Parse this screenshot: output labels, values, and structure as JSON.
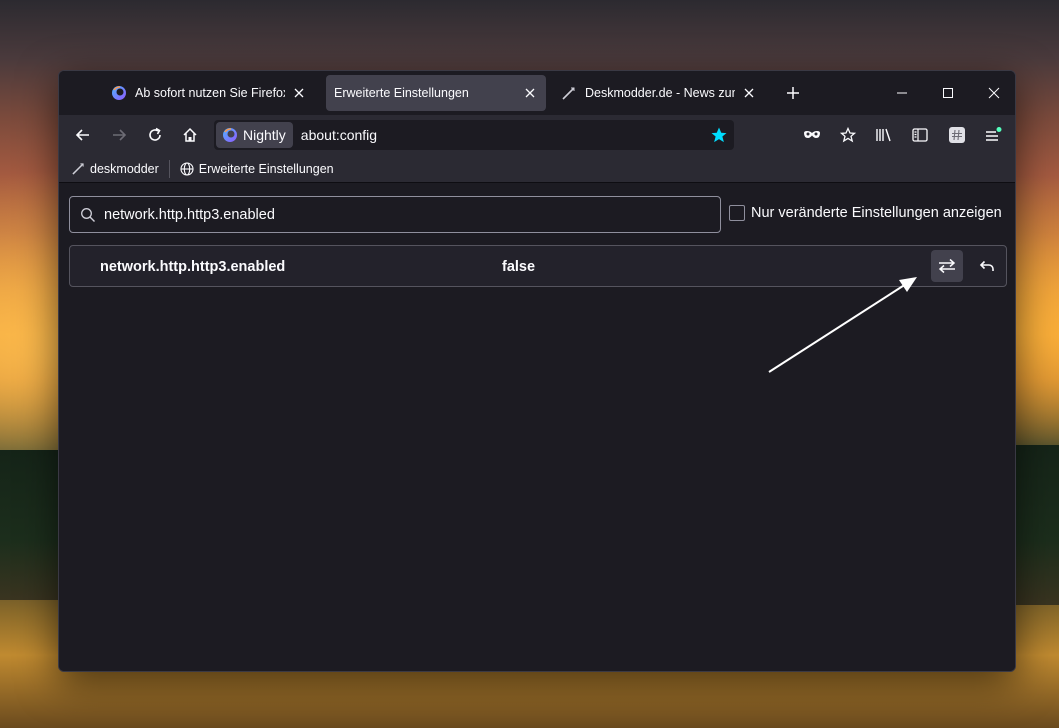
{
  "tabs": [
    {
      "title": "Ab sofort nutzen Sie Firefox Nightly",
      "icon": "nightly-icon",
      "active": false
    },
    {
      "title": "Erweiterte Einstellungen",
      "icon": "",
      "active": true
    },
    {
      "title": "Deskmodder.de - News zum Thema",
      "icon": "deskmodder-icon",
      "active": false
    }
  ],
  "urlbar": {
    "identity_label": "Nightly",
    "url": "about:config"
  },
  "bookmarks": [
    {
      "label": "deskmodder",
      "icon": "deskmodder-icon"
    },
    {
      "label": "Erweiterte Einstellungen",
      "icon": "globe-icon"
    }
  ],
  "config": {
    "search_value": "network.http.http3.enabled",
    "show_modified_label": "Nur veränderte Einstellungen anzeigen",
    "pref": {
      "name": "network.http.http3.enabled",
      "value": "false"
    }
  },
  "colors": {
    "accent": "#00ddff",
    "window_bg": "#1c1b22",
    "toolbar_bg": "#2b2a33",
    "active_tab": "#42414d",
    "text": "#fbfbfe"
  }
}
